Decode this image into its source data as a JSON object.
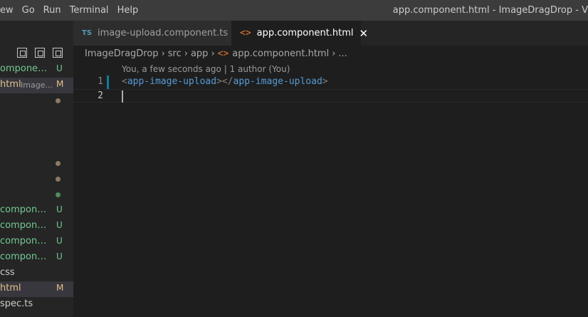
{
  "menu": [
    "ew",
    "Go",
    "Run",
    "Terminal",
    "Help"
  ],
  "window_title": "app.component.html - ImageDragDrop - V",
  "tabs": [
    {
      "icon": "TS",
      "label": "image-upload.component.ts",
      "active": false
    },
    {
      "icon": "<>",
      "label": "app.component.html",
      "active": true,
      "close": "✕"
    }
  ],
  "breadcrumb": {
    "parts": [
      "ImageDragDrop",
      "src",
      "app"
    ],
    "file_icon": "<>",
    "file": "app.component.html",
    "more": "..."
  },
  "sidebar": {
    "files": [
      {
        "name": "omponent.t...",
        "badge": "U",
        "status": "untracked"
      },
      {
        "name": "html",
        "desc": "Image...",
        "badge": "M",
        "status": "modified",
        "selected": true
      },
      {
        "name": "",
        "badge": "",
        "dot": "modified"
      },
      {
        "name": "",
        "badge": "",
        "dot": "none"
      },
      {
        "name": "",
        "badge": "",
        "dot": "none"
      },
      {
        "name": "",
        "badge": "",
        "dot": "none"
      },
      {
        "name": "",
        "badge": "",
        "dot": "modified"
      },
      {
        "name": "",
        "badge": "",
        "dot": "modified"
      },
      {
        "name": "",
        "badge": "",
        "dot": "untracked"
      },
      {
        "name": "component...",
        "badge": "U",
        "status": "untracked"
      },
      {
        "name": "component...",
        "badge": "U",
        "status": "untracked"
      },
      {
        "name": "component...",
        "badge": "U",
        "status": "untracked"
      },
      {
        "name": "component...",
        "badge": "U",
        "status": "untracked"
      },
      {
        "name": "css",
        "badge": "",
        "status": "normal"
      },
      {
        "name": "html",
        "badge": "M",
        "status": "modified",
        "selected": true
      },
      {
        "name": "spec.ts",
        "badge": "",
        "status": "normal"
      }
    ]
  },
  "editor": {
    "codelens": "You, a few seconds ago | 1 author (You)",
    "lines": [
      {
        "number": "1",
        "open_bracket": "<",
        "open_tag": "app-image-upload",
        "mid_bracket": "></",
        "close_tag": "app-image-upload",
        "end_bracket": ">"
      },
      {
        "number": "2"
      }
    ]
  },
  "colors": {
    "untracked": "#73c991",
    "modified": "#e2c08d",
    "modified_dot": "#8c7b62",
    "untracked_dot": "#4e8c5f",
    "tag": "#569cd6",
    "accent_html": "#e37933",
    "accent_ts": "#519aba"
  }
}
